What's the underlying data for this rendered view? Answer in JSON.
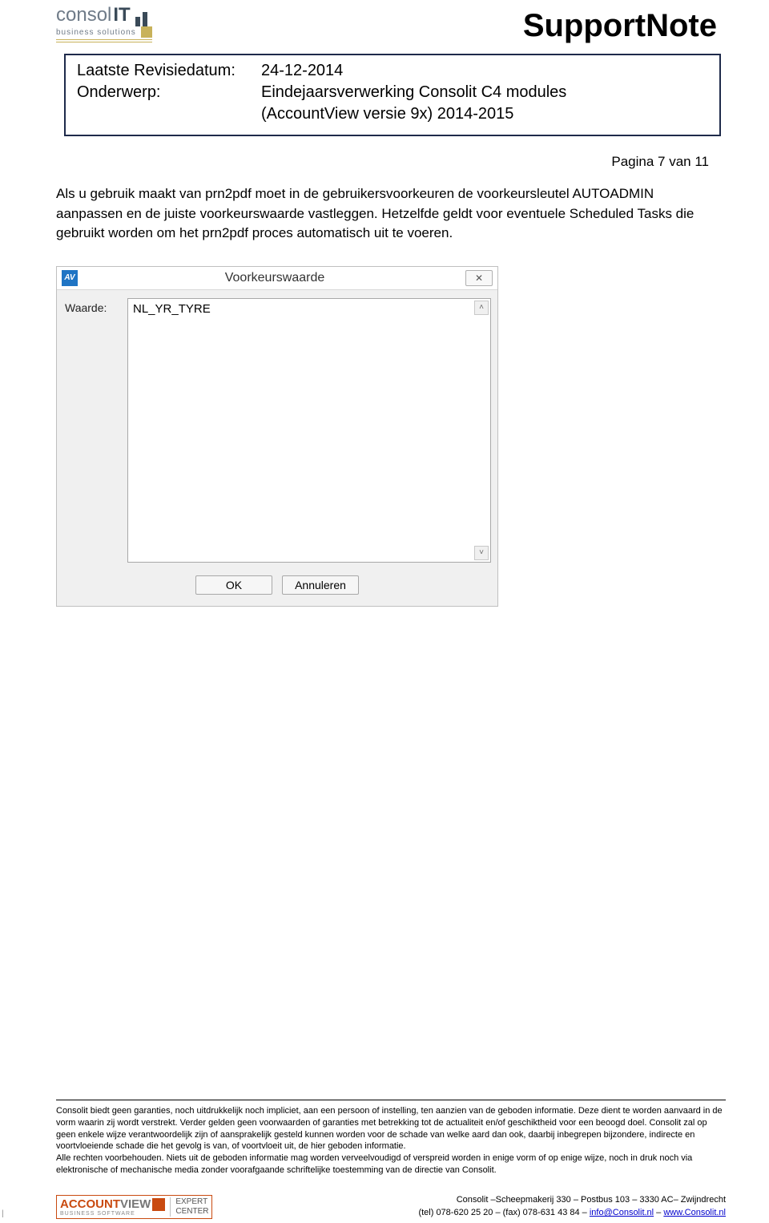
{
  "header": {
    "logo_text_1": "consol",
    "logo_text_bold": "IT",
    "logo_sub": "business solutions",
    "title": "SupportNote",
    "meta_label_1": "Laatste Revisiedatum:",
    "meta_value_1": "24-12-2014",
    "meta_label_2": "Onderwerp:",
    "meta_value_2": "Eindejaarsverwerking Consolit C4 modules",
    "meta_value_2b": "(AccountView versie 9x) 2014-2015"
  },
  "page_number": "Pagina 7 van 11",
  "body": "Als u gebruik maakt van prn2pdf moet in de gebruikersvoorkeuren de voorkeursleutel AUTOADMIN aanpassen en de juiste voorkeurswaarde vastleggen. Hetzelfde geldt voor eventuele Scheduled Tasks die gebruikt worden om het prn2pdf proces automatisch uit te voeren.",
  "modal": {
    "icon": "AV",
    "title": "Voorkeurswaarde",
    "close": "✕",
    "field_label": "Waarde:",
    "value": "NL_YR_TYRE",
    "scroll_up": "˄",
    "scroll_down": "˅",
    "ok": "OK",
    "cancel": "Annuleren"
  },
  "disclaimer": {
    "p1": "Consolit biedt geen garanties, noch uitdrukkelijk noch impliciet, aan een persoon of instelling, ten aanzien van de geboden informatie. Deze dient te worden aanvaard in de vorm waarin zij wordt verstrekt. Verder gelden geen voorwaarden of garanties met betrekking tot de actualiteit en/of geschiktheid voor een beoogd doel. Consolit zal op geen enkele wijze verantwoordelijk zijn of aansprakelijk gesteld kunnen worden voor de schade van welke aard dan ook, daarbij inbegrepen bijzondere, indirecte en voortvloeiende schade die het gevolg is van, of voortvloeit uit, de hier geboden informatie.",
    "p2": "Alle rechten voorbehouden. Niets uit de geboden informatie mag worden verveelvoudigd of verspreid worden in enige vorm of op enige wijze, noch in druk noch via elektronische of mechanische media zonder voorafgaande schriftelijke toestemming van de directie van Consolit."
  },
  "footer_logo": {
    "brand_1": "ACCOUNT",
    "brand_2": "VIEW",
    "brand_sub": "BUSINESS SOFTWARE",
    "badge_1": "EXPERT",
    "badge_2": "CENTER"
  },
  "contact": {
    "line1_pre": "Consolit –Scheepmakerij 330 – Postbus 103 – 3330 AC– Zwijndrecht",
    "line2_pre": "(tel) 078-620 25 20 – (fax) 078-631 43 84 – ",
    "email": "info@Consolit.nl",
    "sep": " – ",
    "web": "www.Consolit.nl"
  },
  "left_mark": "|"
}
